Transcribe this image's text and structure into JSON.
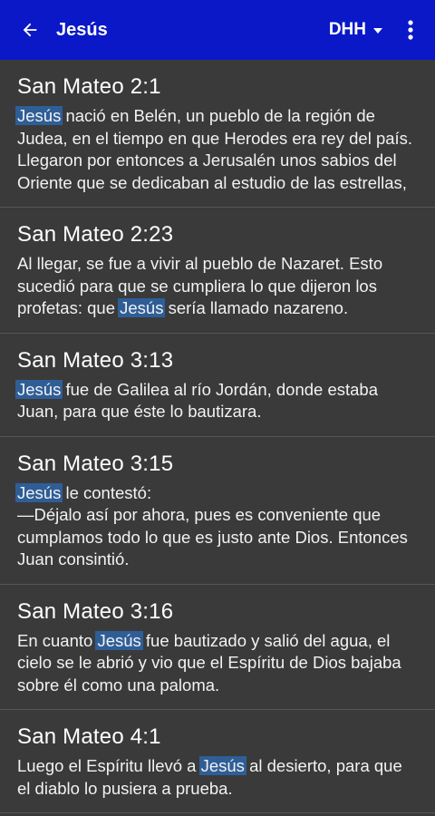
{
  "appbar": {
    "title": "Jesús",
    "version": "DHH"
  },
  "colors": {
    "appbar": "#0a18c8",
    "background": "#3a3a3a",
    "highlight": "#2f5e97"
  },
  "icons": {
    "back": "arrow-left",
    "version_dropdown": "caret-down",
    "more": "vertical-dots"
  },
  "results": [
    {
      "ref": "San Mateo 2:1",
      "before": "",
      "match": "Jesús",
      "after": " nació en Belén, un pueblo de la región de Judea, en el tiempo en que Herodes era rey del país. Llegaron por entonces a Jerusalén unos sabios del Oriente que se dedicaban al estudio de las estrellas,"
    },
    {
      "ref": "San Mateo 2:23",
      "before": "Al llegar, se fue a vivir al pueblo de Nazaret. Esto sucedió para que se cumpliera lo que dijeron los profetas: que ",
      "match": "Jesús",
      "after": " sería llamado nazareno."
    },
    {
      "ref": "San Mateo 3:13",
      "before": "",
      "match": "Jesús",
      "after": " fue de Galilea al río Jordán, donde estaba Juan, para que éste lo bautizara."
    },
    {
      "ref": "San Mateo 3:15",
      "before": "",
      "match": "Jesús",
      "after": " le contestó:\n—Déjalo así por ahora, pues es conveniente que cumplamos todo lo que es justo ante Dios. Entonces Juan consintió."
    },
    {
      "ref": "San Mateo 3:16",
      "before": "En cuanto ",
      "match": "Jesús",
      "after": " fue bautizado y salió del agua, el cielo se le abrió y vio que el Espíritu de Dios bajaba sobre él como una paloma."
    },
    {
      "ref": "San Mateo 4:1",
      "before": "Luego el Espíritu llevó a ",
      "match": "Jesús",
      "after": " al desierto, para que el diablo lo pusiera a prueba."
    }
  ]
}
